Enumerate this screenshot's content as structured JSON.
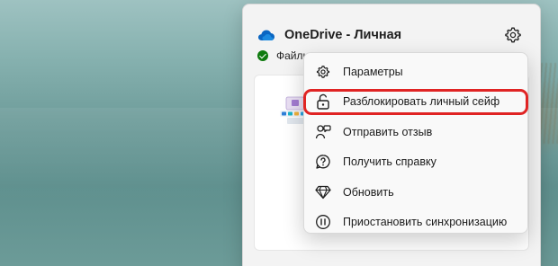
{
  "panel": {
    "title": "OneDrive - Личная",
    "status_text": "Файлы синхронизированы"
  },
  "menu": {
    "items": [
      {
        "label": "Параметры",
        "icon": "gear-icon"
      },
      {
        "label": "Разблокировать личный сейф",
        "icon": "padlock-unlocked-icon",
        "highlighted": true
      },
      {
        "label": "Отправить отзыв",
        "icon": "feedback-icon"
      },
      {
        "label": "Получить справку",
        "icon": "help-icon"
      },
      {
        "label": "Обновить",
        "icon": "diamond-icon"
      },
      {
        "label": "Приостановить синхронизацию",
        "icon": "pause-icon"
      }
    ]
  },
  "colors": {
    "highlight_border": "#e02424",
    "status_ok": "#0f7b0f",
    "onedrive_blue": "#0a66c2"
  }
}
